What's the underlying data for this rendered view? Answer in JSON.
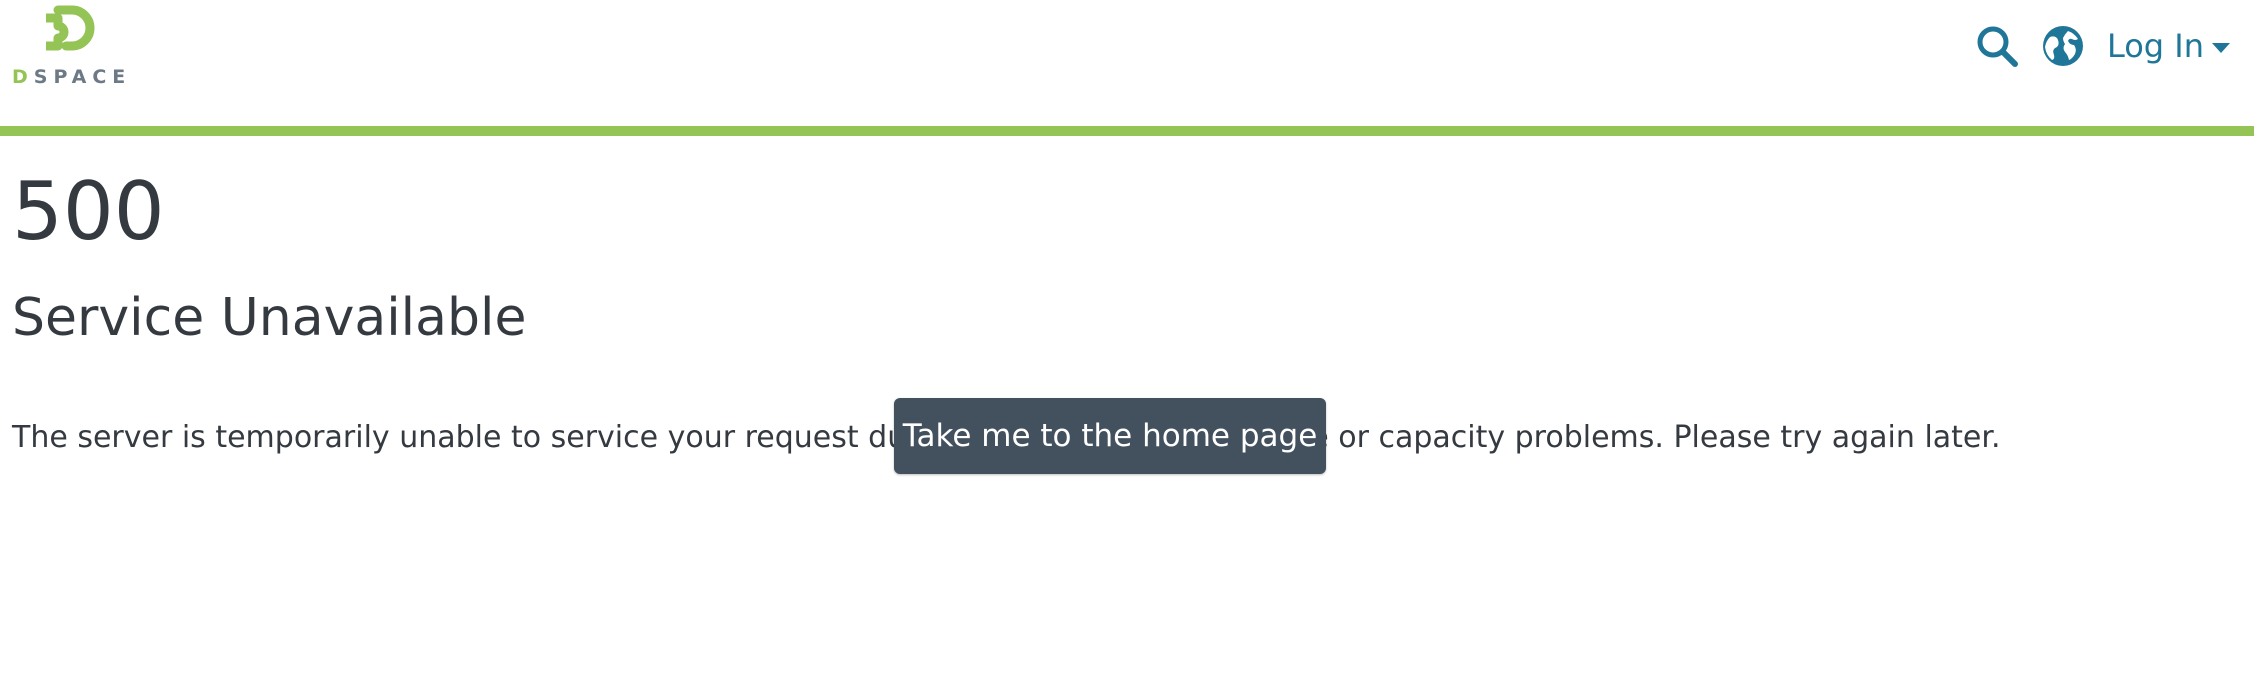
{
  "header": {
    "logo_text_first": "D",
    "logo_text_rest": "SPACE",
    "search_icon": "search-icon",
    "language_icon": "globe-icon",
    "login_label": "Log In",
    "accent_color": "#94c356",
    "link_color": "#207698"
  },
  "main": {
    "error_code": "500",
    "error_title": "Service Unavailable",
    "error_message": "The server is temporarily unable to service your request due to maintenance downtime or capacity problems. Please try again later.",
    "home_button_label": "Take me to the home page",
    "button_color": "#43515f"
  }
}
